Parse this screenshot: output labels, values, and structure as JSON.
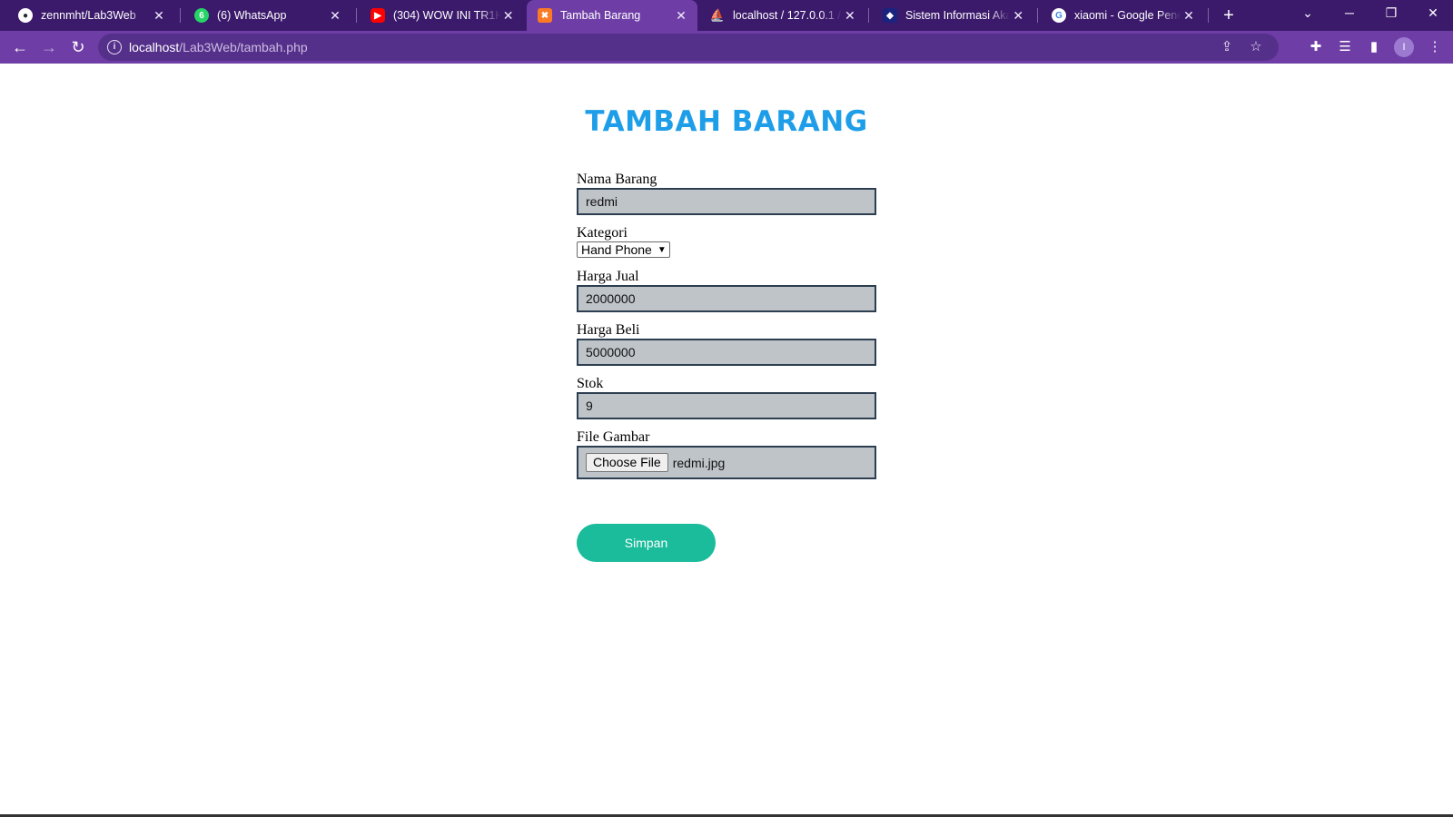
{
  "browser": {
    "tabs": [
      {
        "title": "zennmht/Lab3Web",
        "icon": "github-icon",
        "active": false
      },
      {
        "title": "(6) WhatsApp",
        "icon": "whatsapp-icon",
        "active": false
      },
      {
        "title": "(304) WOW INI TR1K TE",
        "icon": "youtube-icon",
        "active": false
      },
      {
        "title": "Tambah Barang",
        "icon": "xampp-icon",
        "active": true
      },
      {
        "title": "localhost / 127.0.0.1 / la",
        "icon": "phpmyadmin-icon",
        "active": false
      },
      {
        "title": "Sistem Informasi Akade",
        "icon": "university-icon",
        "active": false
      },
      {
        "title": "xiaomi - Google Penelu",
        "icon": "google-icon",
        "active": false
      }
    ],
    "url_host": "localhost",
    "url_path": "/Lab3Web/tambah.php",
    "profile_initial": "I",
    "accent_color": "#6e3ea6"
  },
  "page": {
    "title": "TAMBAH BARANG",
    "fields": {
      "nama_label": "Nama Barang",
      "nama_value": "redmi",
      "kategori_label": "Kategori",
      "kategori_value": "Hand Phone",
      "harga_jual_label": "Harga Jual",
      "harga_jual_value": "2000000",
      "harga_beli_label": "Harga Beli",
      "harga_beli_value": "5000000",
      "stok_label": "Stok",
      "stok_value": "9",
      "gambar_label": "File Gambar",
      "file_button": "Choose File",
      "file_name": "redmi.jpg"
    },
    "submit_label": "Simpan",
    "title_color": "#1e9ee8",
    "button_color": "#1abc9c"
  }
}
